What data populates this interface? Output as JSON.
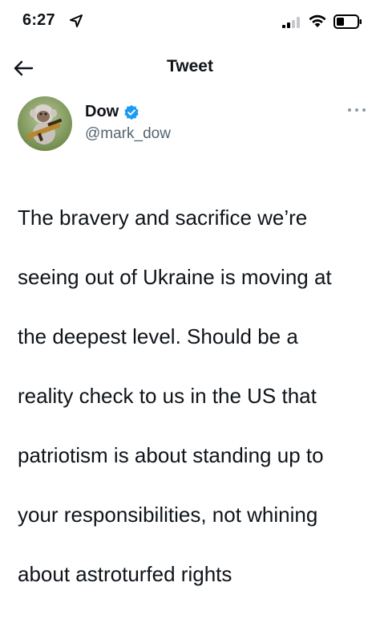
{
  "status_bar": {
    "time": "6:27",
    "icons": [
      "location-arrow-icon",
      "signal-icon",
      "wifi-icon",
      "battery-icon"
    ]
  },
  "header": {
    "title": "Tweet",
    "back_icon": "back-arrow-icon"
  },
  "author": {
    "display_name": "Dow",
    "handle": "@mark_dow",
    "verified": true,
    "verified_color": "#1d9bf0",
    "more_icon": "more-options-icon"
  },
  "tweet": {
    "lines": [
      "The bravery and sacrifice we’re",
      "seeing out of Ukraine is moving at",
      "the deepest level. Should be a",
      "reality check to us in the US that",
      "patriotism is about standing up to",
      "your responsibilities, not whining",
      "about astroturfed rights"
    ]
  },
  "colors": {
    "text": "#0f1419",
    "secondary": "#536471",
    "accent": "#1d9bf0"
  }
}
